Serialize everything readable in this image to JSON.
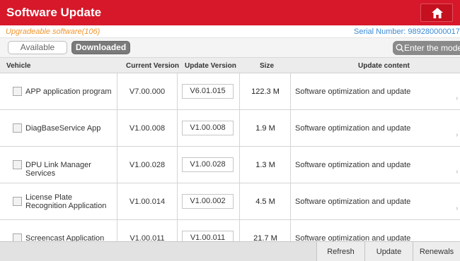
{
  "header": {
    "title": "Software Update",
    "home_icon": "home-icon"
  },
  "info": {
    "upgradeable": "Upgradeable software(106)",
    "serial": "Serial Number: 989280000017"
  },
  "tabs": {
    "available": "Available",
    "downloaded": "Downloaded"
  },
  "search": {
    "placeholder": "Enter the mode...",
    "icon": "search-icon"
  },
  "columns": {
    "vehicle": "Vehicle",
    "current": "Current Version",
    "update": "Update Version",
    "size": "Size",
    "content": "Update content"
  },
  "rows": [
    {
      "name": "APP application program",
      "current": "V7.00.000",
      "update": "V6.01.015",
      "size": "122.3 M",
      "content": "Software optimization and update"
    },
    {
      "name": "DiagBaseService App",
      "current": "V1.00.008",
      "update": "V1.00.008",
      "size": "1.9 M",
      "content": "Software optimization and update"
    },
    {
      "name": "DPU Link Manager Services",
      "current": "V1.00.028",
      "update": "V1.00.028",
      "size": "1.3 M",
      "content": "Software optimization and update"
    },
    {
      "name": "License Plate Recognition Application",
      "current": "V1.00.014",
      "update": "V1.00.002",
      "size": "4.5 M",
      "content": "Software optimization and update"
    },
    {
      "name": "Screencast Application",
      "current": "V1.00.011",
      "update": "V1.00.011",
      "size": "21.7 M",
      "content": "Software optimization and update"
    }
  ],
  "row_arrow": "›",
  "footer": {
    "refresh": "Refresh",
    "update": "Update",
    "renewals": "Renewals"
  },
  "colors": {
    "title_bar": "#d7182a",
    "upgradeable_text": "#f0952e",
    "serial_text": "#3a8ad6",
    "active_tab": "#7a7a7a"
  }
}
